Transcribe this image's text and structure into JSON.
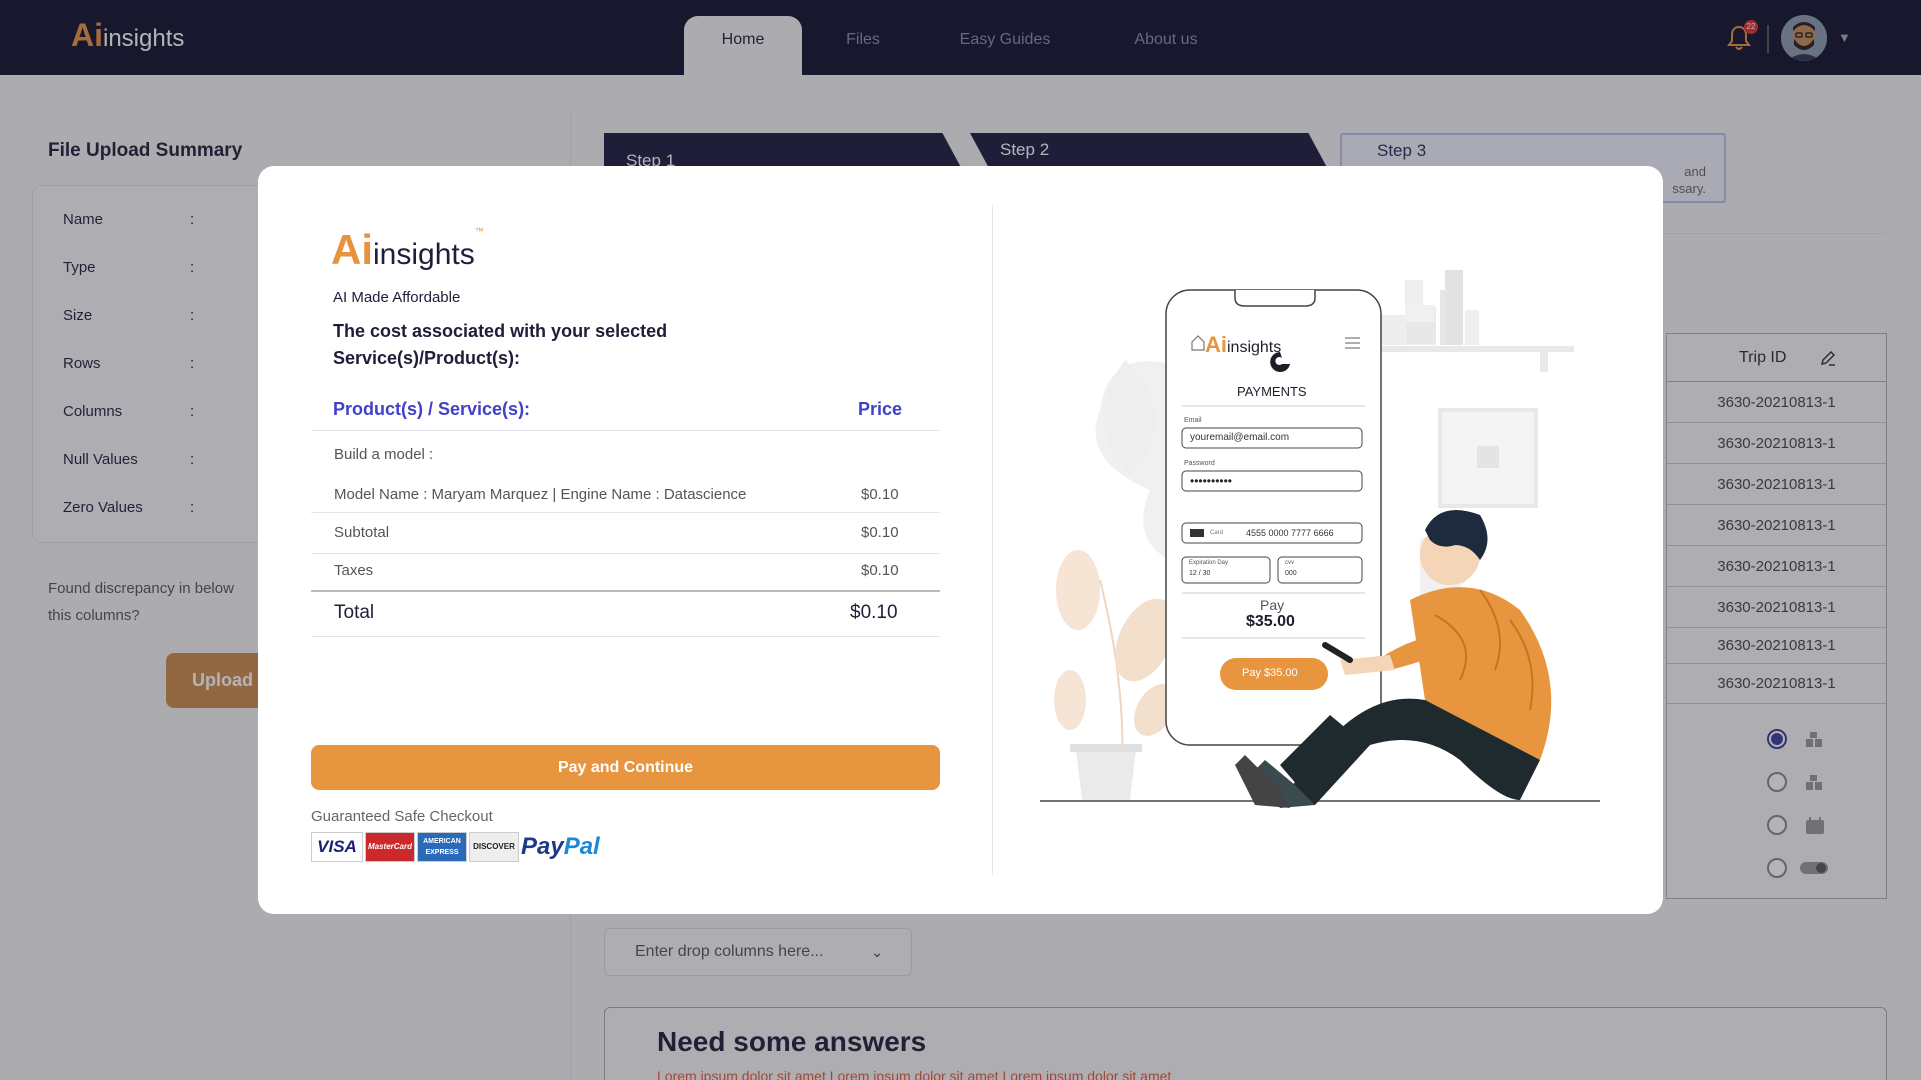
{
  "header": {
    "logo": {
      "ai": "Ai",
      "rest": "insights"
    },
    "tabs": [
      "Home",
      "Files",
      "Easy Guides",
      "About us"
    ],
    "active_tab": "Home",
    "notifications": "22",
    "colors": {
      "bg": "#0e0e2c",
      "accent": "#e8913f"
    }
  },
  "left": {
    "title": "File Upload Summary",
    "fields": [
      "Name",
      "Type",
      "Size",
      "Rows",
      "Columns",
      "Null Values",
      "Zero Values"
    ],
    "colon": ":",
    "discrepancy_line1": "Found discrepancy in below",
    "discrepancy_line2": "this columns?",
    "upload_label": "Upload"
  },
  "steps": [
    "Step 1",
    "Step 2",
    "Step 3"
  ],
  "step3_note_1": "and",
  "step3_note_2": "ssary.",
  "table": {
    "header": "Trip ID",
    "rows": [
      "3630-20210813-1",
      "3630-20210813-1",
      "3630-20210813-1",
      "3630-20210813-1",
      "3630-20210813-1",
      "3630-20210813-1",
      "3630-20210813-1",
      "3630-20210813-1"
    ]
  },
  "drop_columns": {
    "placeholder": "Enter drop columns here..."
  },
  "answers": {
    "title": "Need some answers",
    "text": "Lorem ipsum dolor sit amet Lorem ipsum dolor sit amet Lorem ipsum dolor sit amet"
  },
  "modal": {
    "logo": {
      "ai": "Ai",
      "rest": "insights",
      "tm": "™"
    },
    "tagline": "AI Made Affordable",
    "heading": "The cost associated with your selected Service(s)/Product(s):",
    "col_product": "Product(s) / Service(s):",
    "col_price": "Price",
    "section": "Build a model :",
    "item": {
      "name": "Model Name : Maryam Marquez | Engine Name : Datascience",
      "price": "$0.10"
    },
    "subtotal": {
      "label": "Subtotal",
      "value": "$0.10"
    },
    "taxes": {
      "label": "Taxes",
      "value": "$0.10"
    },
    "total": {
      "label": "Total",
      "value": "$0.10"
    },
    "pay_button": "Pay and Continue",
    "safe_checkout": "Guaranteed Safe Checkout",
    "cards": [
      "VISA",
      "MasterCard",
      "AMERICAN EXPRESS",
      "DISCOVER"
    ],
    "paypal": {
      "pay": "Pay",
      "pal": "Pal"
    },
    "illustration": {
      "app_ai": "Ai",
      "app_rest": "insights",
      "payments": "PAYMENTS",
      "email_label": "Email",
      "email": "youremail@email.com",
      "password_label": "Password",
      "password": "••••••••••",
      "card_label": "Card",
      "card_number": "4555 0000 7777 6666",
      "exp_label": "Expiration Day",
      "exp": "12 / 30",
      "cvv_label": "cvv",
      "cvv": "000",
      "pay_label": "Pay",
      "amount": "$35.00",
      "pay_button": "Pay $35.00"
    }
  }
}
